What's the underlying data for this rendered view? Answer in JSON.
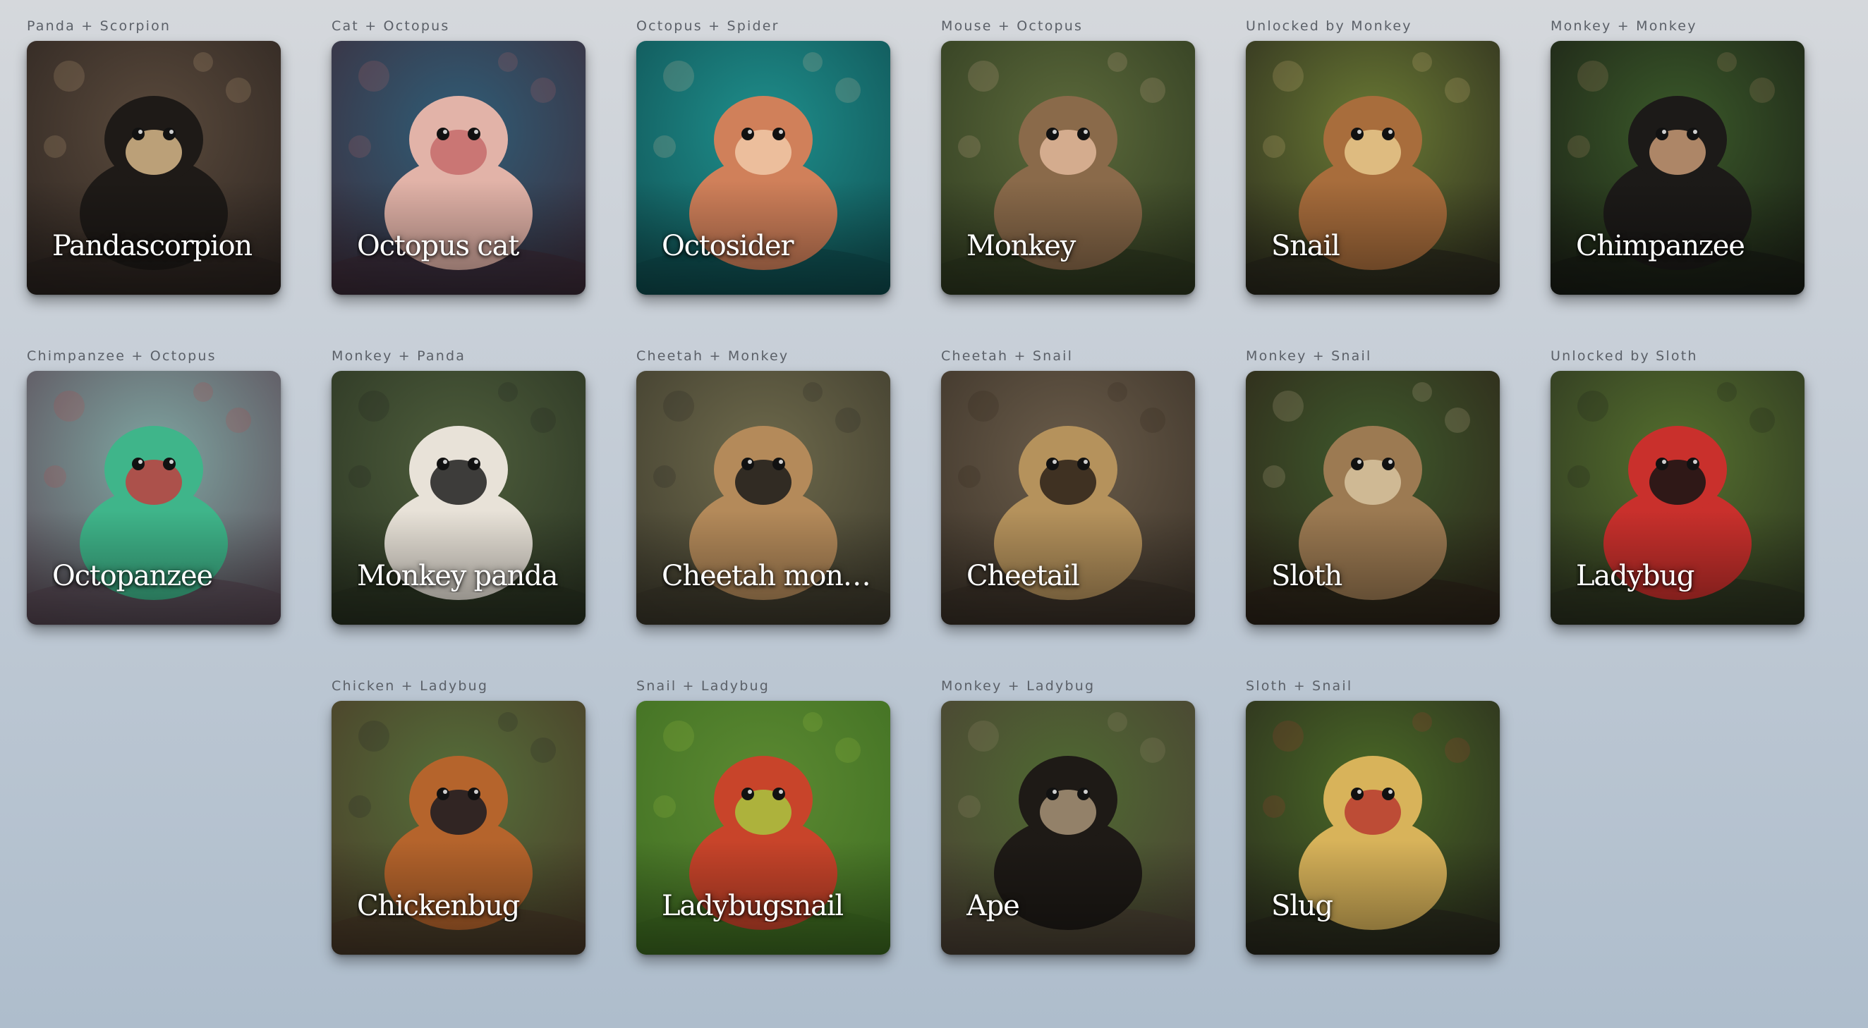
{
  "tiles": [
    {
      "recipe": "Panda + Scorpion",
      "name": "Pandascorpion",
      "icon": "spider-image",
      "colors": {
        "bg1": "#5a4a3c",
        "bg2": "#2c2420",
        "subject": "#1e1a17",
        "accent": "#d7b98a"
      }
    },
    {
      "recipe": "Cat + Octopus",
      "name": "Octopus cat",
      "icon": "octopus-cat-image",
      "colors": {
        "bg1": "#2f5d77",
        "bg2": "#3d2c3a",
        "subject": "#e2b3a8",
        "accent": "#c56b6b"
      }
    },
    {
      "recipe": "Octopus + Spider",
      "name": "Octosider",
      "icon": "octopus-image",
      "colors": {
        "bg1": "#1f8f8c",
        "bg2": "#0f4f52",
        "subject": "#d0805a",
        "accent": "#f1c9a8"
      }
    },
    {
      "recipe": "Mouse + Octopus",
      "name": "Monkey",
      "icon": "monkey-image",
      "colors": {
        "bg1": "#5c6a3b",
        "bg2": "#2f3a20",
        "subject": "#8a6a4a",
        "accent": "#e0b79a"
      }
    },
    {
      "recipe": "Unlocked by Monkey",
      "name": "Snail",
      "icon": "snail-image",
      "colors": {
        "bg1": "#6a7a34",
        "bg2": "#2b2a1d",
        "subject": "#a86d3c",
        "accent": "#e7c98c"
      }
    },
    {
      "recipe": "Monkey + Monkey",
      "name": "Chimpanzee",
      "icon": "chimpanzee-image",
      "colors": {
        "bg1": "#3b5a2a",
        "bg2": "#1a1e15",
        "subject": "#1c1a18",
        "accent": "#c79a76"
      }
    },
    {
      "recipe": "Chimpanzee + Octopus",
      "name": "Octopanzee",
      "icon": "octopanzee-image",
      "colors": {
        "bg1": "#7fa6a2",
        "bg2": "#5a4a56",
        "subject": "#3fb58a",
        "accent": "#c04040"
      }
    },
    {
      "recipe": "Monkey + Panda",
      "name": "Monkey panda",
      "icon": "panda-image",
      "colors": {
        "bg1": "#4e5e3c",
        "bg2": "#2a3322",
        "subject": "#e8e2d8",
        "accent": "#1e1e1e"
      }
    },
    {
      "recipe": "Cheetah + Monkey",
      "name": "Cheetah monkey",
      "icon": "cheetah-monkey-image",
      "colors": {
        "bg1": "#6e6a4c",
        "bg2": "#3d3a2c",
        "subject": "#b48a5a",
        "accent": "#1a1a1a"
      }
    },
    {
      "recipe": "Cheetah + Snail",
      "name": "Cheetail",
      "icon": "cheetah-image",
      "colors": {
        "bg1": "#6a5c4a",
        "bg2": "#3b3228",
        "subject": "#b5925c",
        "accent": "#2a2018"
      }
    },
    {
      "recipe": "Monkey + Snail",
      "name": "Sloth",
      "icon": "sloth-image",
      "colors": {
        "bg1": "#3f5a2c",
        "bg2": "#2d2419",
        "subject": "#9c7a52",
        "accent": "#d8c4a0"
      }
    },
    {
      "recipe": "Unlocked by Sloth",
      "name": "Ladybug",
      "icon": "ladybug-image",
      "colors": {
        "bg1": "#55702e",
        "bg2": "#2c3320",
        "subject": "#c9302c",
        "accent": "#141414"
      }
    },
    {
      "recipe": "Chicken + Ladybug",
      "name": "Chickenbug",
      "icon": "bug-image",
      "colors": {
        "bg1": "#55703a",
        "bg2": "#4a3a28",
        "subject": "#b5642c",
        "accent": "#1a1a22"
      }
    },
    {
      "recipe": "Snail + Ladybug",
      "name": "Ladybugsnail",
      "icon": "ladybug-snail-image",
      "colors": {
        "bg1": "#5c8a32",
        "bg2": "#3f6e22",
        "subject": "#c8442a",
        "accent": "#a8c640"
      }
    },
    {
      "recipe": "Monkey + Ladybug",
      "name": "Ape",
      "icon": "ape-image",
      "colors": {
        "bg1": "#4f6a32",
        "bg2": "#4b4034",
        "subject": "#1e1a16",
        "accent": "#a89478"
      }
    },
    {
      "recipe": "Sloth + Snail",
      "name": "Slug",
      "icon": "slug-image",
      "colors": {
        "bg1": "#4a6a26",
        "bg2": "#2a2a1e",
        "subject": "#d8b35a",
        "accent": "#b83a30"
      }
    }
  ]
}
